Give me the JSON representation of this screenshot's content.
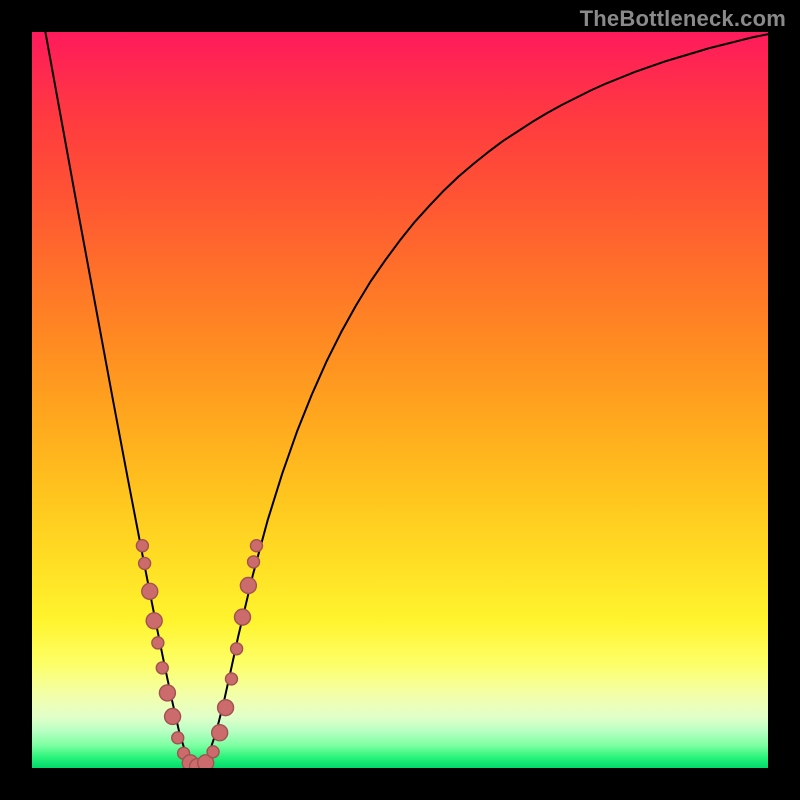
{
  "watermark": "TheBottleneck.com",
  "colors": {
    "frame": "#000000",
    "curve": "#000000",
    "point_fill": "#cc6b6b",
    "point_stroke": "#a05252"
  },
  "chart_data": {
    "type": "line",
    "title": "",
    "xlabel": "",
    "ylabel": "",
    "xlim": [
      0,
      100
    ],
    "ylim": [
      0,
      100
    ],
    "x": [
      0,
      1,
      2,
      3,
      4,
      5,
      6,
      7,
      8,
      9,
      10,
      11,
      12,
      13,
      14,
      15,
      16,
      17,
      18,
      19,
      20,
      21,
      22,
      23,
      24,
      25,
      26,
      27,
      28,
      30,
      32,
      34,
      36,
      38,
      40,
      42,
      44,
      46,
      48,
      50,
      52,
      54,
      56,
      58,
      60,
      62,
      64,
      66,
      68,
      70,
      72,
      74,
      76,
      78,
      80,
      82,
      84,
      86,
      88,
      90,
      92,
      94,
      96,
      98,
      100
    ],
    "series": [
      {
        "name": "bottleneck_curve",
        "values": [
          110.0,
          104.5,
          99.0,
          93.5,
          88.0,
          82.5,
          77.0,
          71.6,
          66.2,
          60.8,
          55.4,
          50.0,
          44.7,
          39.4,
          34.2,
          29.0,
          23.9,
          18.9,
          14.0,
          9.3,
          4.9,
          1.6,
          0.2,
          0.3,
          1.9,
          4.8,
          8.7,
          13.2,
          17.8,
          26.2,
          33.6,
          40.0,
          45.7,
          50.7,
          55.2,
          59.2,
          62.8,
          66.1,
          69.0,
          71.7,
          74.2,
          76.4,
          78.5,
          80.4,
          82.1,
          83.7,
          85.2,
          86.5,
          87.8,
          89.0,
          90.1,
          91.1,
          92.1,
          93.0,
          93.8,
          94.6,
          95.3,
          96.0,
          96.6,
          97.2,
          97.8,
          98.3,
          98.8,
          99.3,
          99.7
        ]
      }
    ],
    "scatter_points": {
      "name": "sample_points",
      "values": [
        {
          "x": 15.0,
          "y": 30.2,
          "r": 6
        },
        {
          "x": 15.3,
          "y": 27.8,
          "r": 6
        },
        {
          "x": 16.0,
          "y": 24.0,
          "r": 8
        },
        {
          "x": 16.6,
          "y": 20.0,
          "r": 8
        },
        {
          "x": 17.1,
          "y": 17.0,
          "r": 6
        },
        {
          "x": 17.7,
          "y": 13.6,
          "r": 6
        },
        {
          "x": 18.4,
          "y": 10.2,
          "r": 8
        },
        {
          "x": 19.1,
          "y": 7.0,
          "r": 8
        },
        {
          "x": 19.8,
          "y": 4.1,
          "r": 6
        },
        {
          "x": 20.6,
          "y": 2.0,
          "r": 6
        },
        {
          "x": 21.5,
          "y": 0.7,
          "r": 8
        },
        {
          "x": 22.5,
          "y": 0.2,
          "r": 8
        },
        {
          "x": 23.6,
          "y": 0.7,
          "r": 8
        },
        {
          "x": 24.6,
          "y": 2.2,
          "r": 6
        },
        {
          "x": 25.5,
          "y": 4.8,
          "r": 8
        },
        {
          "x": 26.3,
          "y": 8.2,
          "r": 8
        },
        {
          "x": 27.1,
          "y": 12.1,
          "r": 6
        },
        {
          "x": 27.8,
          "y": 16.2,
          "r": 6
        },
        {
          "x": 28.6,
          "y": 20.5,
          "r": 8
        },
        {
          "x": 29.4,
          "y": 24.8,
          "r": 8
        },
        {
          "x": 30.1,
          "y": 28.0,
          "r": 6
        },
        {
          "x": 30.5,
          "y": 30.2,
          "r": 6
        }
      ]
    },
    "gradient_stops": [
      {
        "pos": 0,
        "color": "#ff1a5c"
      },
      {
        "pos": 0.5,
        "color": "#ffcc20"
      },
      {
        "pos": 0.86,
        "color": "#fdff69"
      },
      {
        "pos": 1.0,
        "color": "#00d96a"
      }
    ]
  }
}
